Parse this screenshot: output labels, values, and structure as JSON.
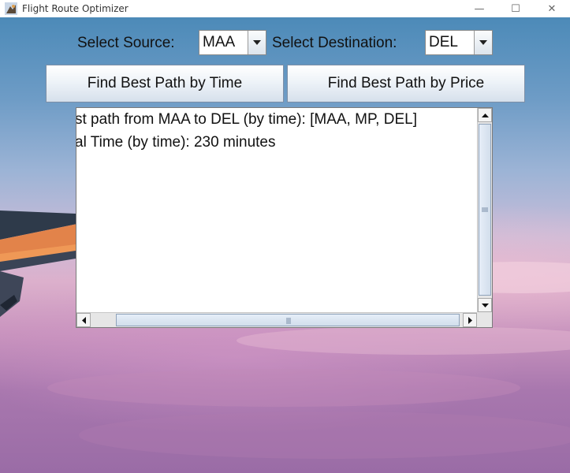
{
  "window": {
    "title": "Flight Route Optimizer",
    "icon": "app-icon",
    "controls": {
      "minimize": "—",
      "maximize": "☐",
      "close": "✕"
    }
  },
  "source": {
    "label": "Select Source:",
    "value": "MAA"
  },
  "destination": {
    "label": "Select Destination:",
    "value": "DEL"
  },
  "buttons": {
    "by_time": "Find Best Path by Time",
    "by_price": "Find Best Path by Price"
  },
  "output": {
    "lines": [
      "st path from MAA to DEL (by time): [MAA, MP, DEL]",
      "al Time (by time): 230 minutes"
    ]
  }
}
